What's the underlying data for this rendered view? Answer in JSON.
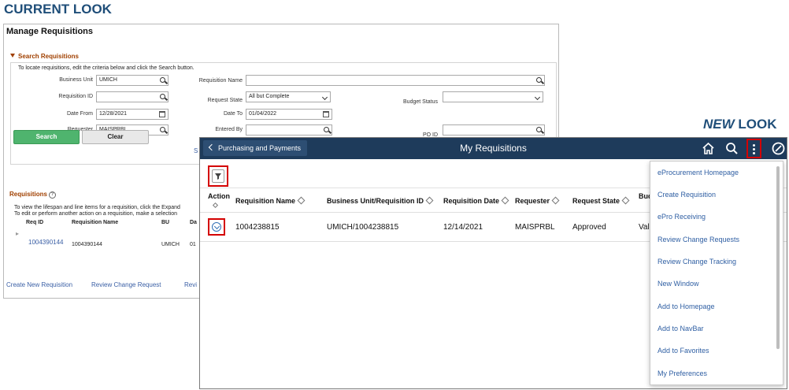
{
  "headings": {
    "current_look": "CURRENT LOOK",
    "new_look_em": "NEW",
    "new_look_rest": " LOOK"
  },
  "old": {
    "title": "Manage Requisitions",
    "section": "Search Requisitions",
    "instructions": "To locate requisitions, edit the criteria below and click the Search button.",
    "fields": {
      "business_unit_label": "Business Unit",
      "business_unit_value": "UMICH",
      "requisition_id_label": "Requisition ID",
      "requisition_id_value": "",
      "date_from_label": "Date From",
      "date_from_value": "12/28/2021",
      "requester_label": "Requester",
      "requester_value": "MAISPRBL",
      "requisition_name_label": "Requisition Name",
      "requisition_name_value": "",
      "request_state_label": "Request State",
      "request_state_value": "All but Complete",
      "date_to_label": "Date To",
      "date_to_value": "01/04/2022",
      "entered_by_label": "Entered By",
      "entered_by_value": "",
      "budget_status_label": "Budget Status",
      "budget_status_value": "",
      "po_id_label": "PO ID",
      "po_id_value": ""
    },
    "search_button": "Search",
    "clear_button": "Clear",
    "cut_link": "S",
    "requisitions_heading": "Requisitions",
    "help_glyph": "?",
    "lifespan_text_1": "To view the lifespan and line items for a requisition, click the Expand",
    "lifespan_text_2": "To edit or perform another action on a requisition, make a selection",
    "table_headers": [
      "Req ID",
      "Requisition Name",
      "BU",
      "Da"
    ],
    "row": {
      "expand_glyph": "▸",
      "req_id": "1004390144",
      "name": "1004390144",
      "bu": "UMICH",
      "date": "01"
    },
    "bottom_links": [
      "Create New Requisition",
      "Review Change Request",
      "Revi"
    ]
  },
  "new": {
    "back_label": "Purchasing and Payments",
    "page_title": "My Requisitions",
    "columns": [
      "Action",
      "Requisition Name",
      "Business Unit/Requisition ID",
      "Requisition Date",
      "Requester",
      "Request State",
      "Bud"
    ],
    "row": {
      "requisition_name": "1004238815",
      "bu_req_id": "UMICH/1004238815",
      "date": "12/14/2021",
      "requester": "MAISPRBL",
      "state": "Approved",
      "budget": "Val"
    },
    "right_edge_glyph": "w",
    "menu_items": [
      "eProcurement Homepage",
      "Create Requisition",
      "ePro Receiving",
      "Review Change Requests",
      "Review Change Tracking",
      "New Window",
      "Add to Homepage",
      "Add to NavBar",
      "Add to Favorites",
      "My Preferences"
    ],
    "icons": [
      "home-icon",
      "search-icon",
      "actions-menu-icon",
      "navbar-icon",
      "filter-icon"
    ]
  }
}
